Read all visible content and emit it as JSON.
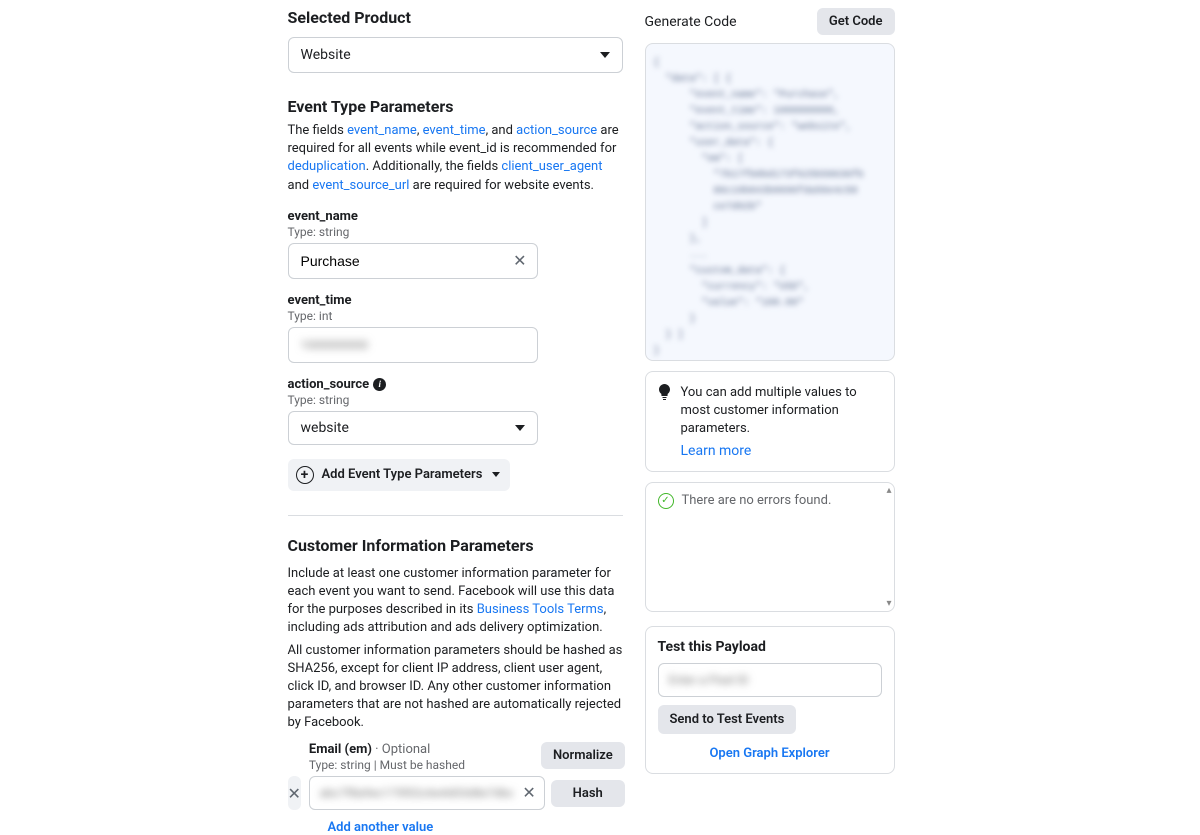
{
  "left": {
    "selected_product": {
      "title": "Selected Product",
      "value": "Website"
    },
    "event_type_params": {
      "title": "Event Type Parameters",
      "desc_prefix": "The fields ",
      "link_event_name": "event_name",
      "comma1": ", ",
      "link_event_time": "event_time",
      "mid1": ", and ",
      "link_action_source": "action_source",
      "mid2": " are required for all events while event_id is recommended for ",
      "link_dedup": "deduplication",
      "mid3": ". Additionally, the fields ",
      "link_cua": "client_user_agent",
      "mid4": " and ",
      "link_esu": "event_source_url",
      "suffix": " are required for website events."
    },
    "event_name": {
      "label": "event_name",
      "type": "Type: string",
      "value": "Purchase"
    },
    "event_time": {
      "label": "event_time",
      "type": "Type: int",
      "blur": "1000000000"
    },
    "action_source": {
      "label": "action_source",
      "type": "Type: string",
      "value": "website"
    },
    "add_params_btn": "Add Event Type Parameters",
    "customer_info": {
      "title": "Customer Information Parameters",
      "desc1_pre": "Include at least one customer information parameter for each event you want to send. Facebook will use this data for the purposes described in its ",
      "link_btt": "Business Tools Terms",
      "desc1_post": ", including ads attribution and ads delivery optimization.",
      "desc2": "All customer information parameters should be hashed as SHA256, except for client IP address, client user agent, click ID, and browser ID. Any other customer information parameters that are not hashed are automatically rejected by Facebook."
    },
    "email": {
      "label": "Email (em)",
      "optional": " · Optional",
      "type": "Type: string | Must be hashed",
      "normalize_btn": "Normalize",
      "hash_btn": "Hash",
      "blur_value": "abc7f8a9ec175f02c6e4d03d8e7dbc"
    },
    "add_another": "Add another value"
  },
  "right": {
    "code_title": "Generate Code",
    "get_code_btn": "Get Code",
    "tip": {
      "text": "You can add multiple values to most customer information parameters.",
      "link": "Learn more"
    },
    "errors": {
      "text": "There are no errors found."
    },
    "test": {
      "title": "Test this Payload",
      "placeholder_blur": "Enter a Pixel ID",
      "send_btn": "Send to Test Events",
      "explorer": "Open Graph Explorer"
    }
  }
}
